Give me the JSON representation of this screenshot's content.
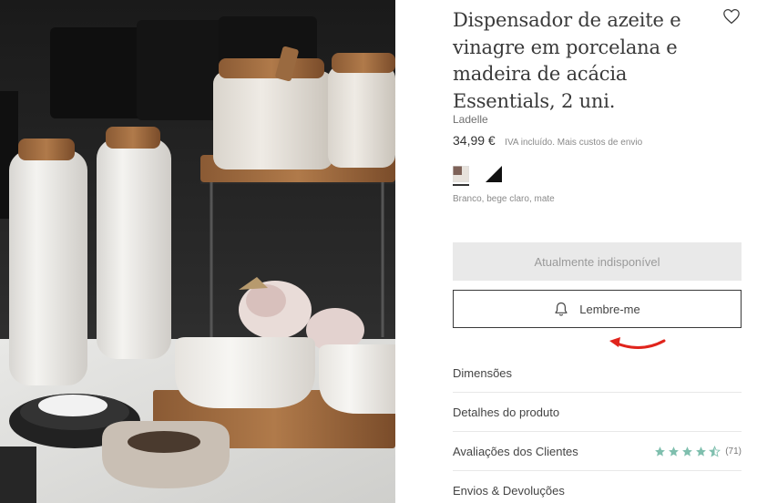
{
  "product": {
    "title": "Dispensador de azeite e vinagre em porcelana e madeira de acácia Essentials, 2 uni.",
    "brand": "Ladelle",
    "price": "34,99 €",
    "vat_note": "IVA incluído. Mais custos de envio",
    "color_name": "Branco, bege claro, mate",
    "swatches": [
      {
        "name": "white-beige-swatch",
        "colors": [
          "#e7e2dc",
          "#7e6258"
        ]
      },
      {
        "name": "black-white-swatch",
        "colors": [
          "#ffffff",
          "#111111"
        ]
      }
    ]
  },
  "actions": {
    "unavailable_label": "Atualmente indisponível",
    "remind_label": "Lembre-me"
  },
  "accordion": [
    {
      "label": "Dimensões"
    },
    {
      "label": "Detalhes do produto"
    },
    {
      "label": "Avaliações dos Clientes",
      "rating": 4.5,
      "reviews": "(71)"
    },
    {
      "label": "Envios & Devoluções"
    }
  ],
  "colors": {
    "star": "#7fbfae",
    "arrow": "#e0241c",
    "button_disabled_bg": "#e9e9e9"
  },
  "icons": [
    "heart-icon",
    "bell-icon",
    "star-icon",
    "arrow-annotation"
  ]
}
